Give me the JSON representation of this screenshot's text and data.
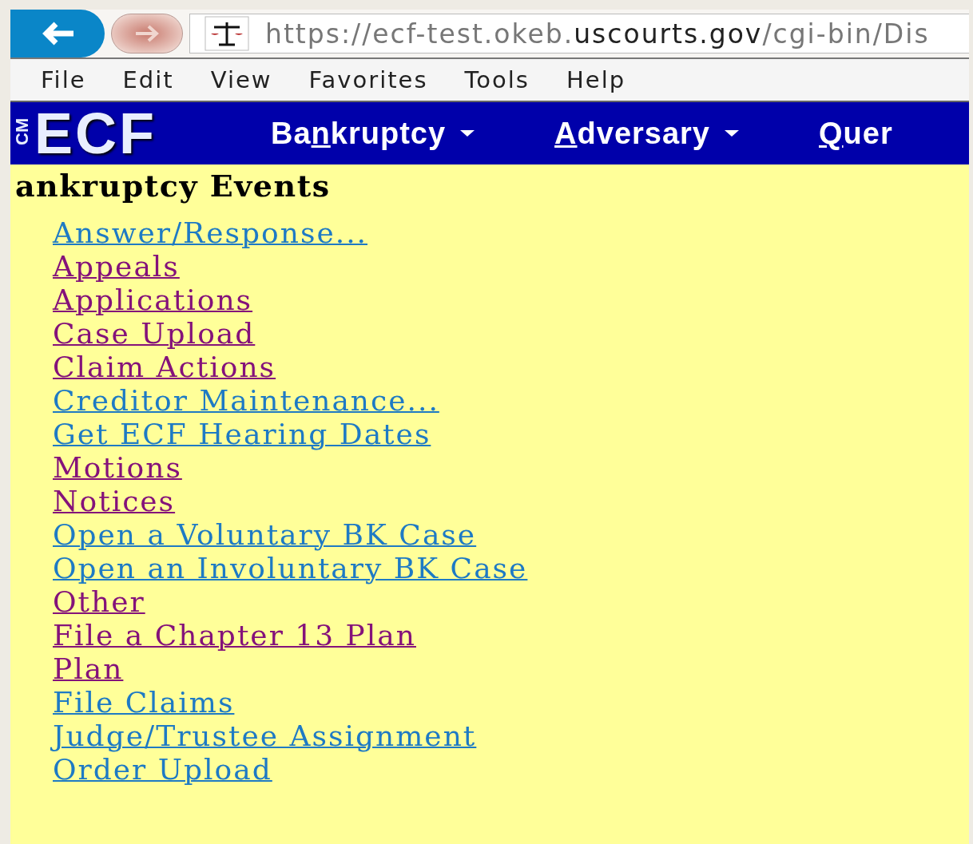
{
  "address_bar": {
    "url_parts": [
      {
        "text": "https://ecf-test.okeb.",
        "emphasis": false
      },
      {
        "text": "uscourts.gov",
        "emphasis": true
      },
      {
        "text": "/cgi-bin/Dis",
        "emphasis": false
      }
    ]
  },
  "menu_bar": [
    "File",
    "Edit",
    "View",
    "Favorites",
    "Tools",
    "Help"
  ],
  "nav_bar": {
    "logo": {
      "small": "CM",
      "large": "ECF"
    },
    "items": [
      {
        "pre": "Ba",
        "key": "n",
        "post": "kruptcy",
        "dropdown": true
      },
      {
        "key": "A",
        "post": "dversary",
        "dropdown": true
      },
      {
        "key": "Q",
        "post": "uer",
        "dropdown": false
      }
    ]
  },
  "heading": "ankruptcy Events",
  "links": [
    {
      "label": "Answer/Response...",
      "visited": false
    },
    {
      "label": "Appeals",
      "visited": true
    },
    {
      "label": "Applications",
      "visited": true
    },
    {
      "label": "Case Upload",
      "visited": true
    },
    {
      "label": "Claim Actions",
      "visited": true
    },
    {
      "label": "Creditor Maintenance...",
      "visited": false
    },
    {
      "label": "Get ECF Hearing Dates",
      "visited": false
    },
    {
      "label": "Motions",
      "visited": true
    },
    {
      "label": "Notices",
      "visited": true
    },
    {
      "label": "Open a Voluntary BK Case",
      "visited": false
    },
    {
      "label": "Open an Involuntary BK Case",
      "visited": false
    },
    {
      "label": "Other",
      "visited": true
    },
    {
      "label": "File a Chapter 13 Plan",
      "visited": true
    },
    {
      "label": "Plan",
      "visited": true
    },
    {
      "label": "File Claims",
      "visited": false
    },
    {
      "label": "Judge/Trustee Assignment",
      "visited": false
    },
    {
      "label": "Order Upload",
      "visited": false
    }
  ]
}
